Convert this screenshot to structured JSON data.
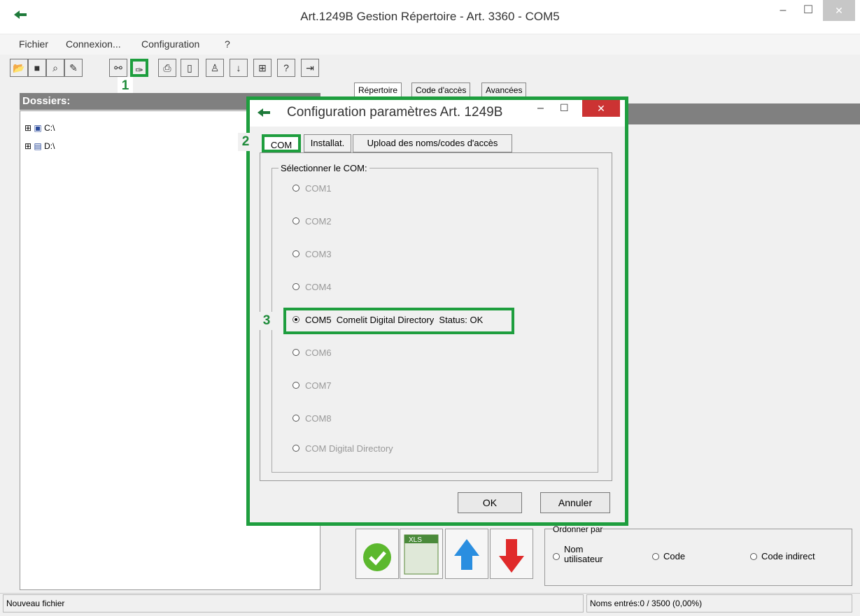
{
  "window": {
    "title": "Art.1249B Gestion Répertoire - Art. 3360 - COM5",
    "min": "–",
    "max": "☐",
    "close": "✕"
  },
  "menu": [
    "Fichier",
    "Connexion...",
    "Configuration",
    "?"
  ],
  "toolbar": {
    "icons": [
      "open-folder-icon",
      "save-icon",
      "search-icon",
      "erase-icon",
      "connect-icon",
      "wrench-icon",
      "printer-icon",
      "card-icon",
      "card2-icon",
      "person-icon",
      "sort-az-icon",
      "plus-icon",
      "help-icon",
      "exit-icon"
    ]
  },
  "annotations": {
    "one": "1",
    "two": "2",
    "three": "3"
  },
  "left": {
    "title": "Dossiers:",
    "drives": [
      "C:\\",
      "D:\\"
    ]
  },
  "right_tabs": [
    "Répertoire",
    "Code d'accès",
    "Avancées"
  ],
  "dialog": {
    "title": "Configuration paramètres Art. 1249B",
    "tabs": [
      "COM",
      "Installat.",
      "Upload des noms/codes d'accès"
    ],
    "group_label": "Sélectionner le COM:",
    "options": [
      "COM1",
      "COM2",
      "COM3",
      "COM4",
      "COM5  Comelit Digital Directory  Status: OK",
      "COM6",
      "COM7",
      "COM8",
      "COM Digital Directory"
    ],
    "selected": "COM5",
    "ok": "OK",
    "cancel": "Annuler"
  },
  "order": {
    "label": "Ordonner par",
    "options": [
      "Nom utilisateur",
      "Code",
      "Code indirect"
    ],
    "nom1": "Nom",
    "nom2": "utilisateur"
  },
  "bottom": {
    "xls": "XLS"
  },
  "status": {
    "left": "Nouveau fichier",
    "right": "Noms entrés:0 /  3500 (0,00%)"
  },
  "colors": {
    "highlight": "#1e9e3e",
    "header_gray": "#808080",
    "close_red": "#cc3333"
  }
}
